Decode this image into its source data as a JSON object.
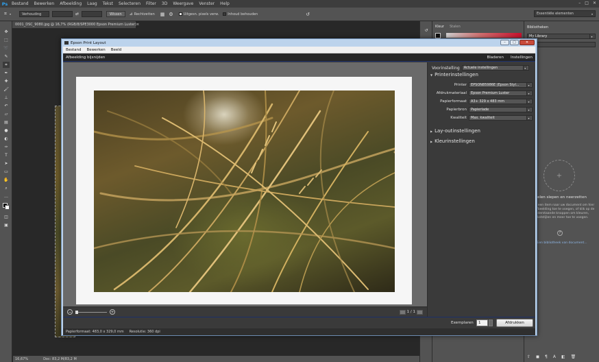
{
  "ps": {
    "logo": "Ps",
    "menu": [
      "Bestand",
      "Bewerken",
      "Afbeelding",
      "Laag",
      "Tekst",
      "Selecteren",
      "Filter",
      "3D",
      "Weergave",
      "Venster",
      "Help"
    ],
    "options": {
      "ratio": "Verhouding",
      "clear": "Wissen",
      "straighten": "Rechtzetten",
      "delete_cropped": "Uitgesn. pixels verw.",
      "content_aware": "Inhoud behouden"
    },
    "workspace": "Essentiële elementen",
    "doc_tab": "0001_DSC_9080.jpg @ 16,7% (RGB/8/SPE3000 Epson Premium Luster)",
    "doc_tab_close": "×",
    "status_zoom": "16,67%",
    "status_doc": "Doc: 83,2 M/83,2 M",
    "panels": {
      "tab_color": "Kleur",
      "tab_swatches": "Stalen",
      "tab_libraries": "Bibliotheken",
      "library_select": "My Library",
      "drag_text": "elen slepen en neerzetten",
      "help_text": "Sleep een item naar uw document om hier een afbeelding toe te voegen, of klik op de onderstaande knoppen om kleuren, tekststijlen en meer toe te voegen.",
      "link_text": "Een bibliotheek van document..."
    }
  },
  "epson": {
    "title": "Epson Print Layout",
    "menu": [
      "Bestand",
      "Bewerken",
      "Beeld"
    ],
    "header_left": "Afbeelding bijsnijden",
    "header_right": [
      "Bladeren",
      "Instellingen"
    ],
    "preset_label": "Voorinstelling",
    "preset_value": "Actuele instellingen",
    "printer_section": "Printerinstellingen",
    "rows": [
      {
        "label": "Printer",
        "value": "EPSON85986E (Epson Styl..."
      },
      {
        "label": "Afdrukmateriaal",
        "value": "Epson Premium Luster"
      },
      {
        "label": "Papierformaat",
        "value": "A3+ 329 x 483 mm"
      },
      {
        "label": "Papierbron",
        "value": "Papierlade"
      },
      {
        "label": "Kwaliteit",
        "value": "Max. kwaliteit"
      }
    ],
    "layout_section": "Lay-outinstellingen",
    "color_section": "Kleurinstellingen",
    "page_indicator": "1 / 1",
    "copies_label": "Exemplaren",
    "copies_value": "1",
    "print_label": "Afdrukken",
    "status_paper": "Papierformaat: 483,0 x 329,0 mm",
    "status_res": "Resolutie: 360 dpi"
  }
}
